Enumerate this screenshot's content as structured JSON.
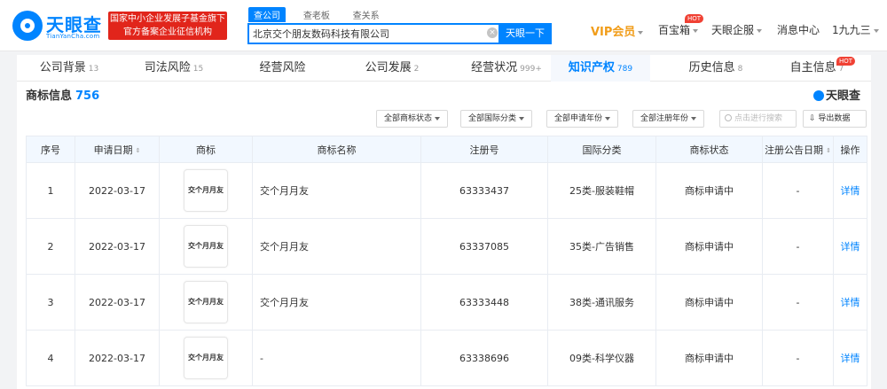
{
  "header": {
    "logo_name": "天眼查",
    "logo_sub": "TianYanCha.com",
    "fund_badge_line1": "国家中小企业发展子基金旗下",
    "fund_badge_line2": "官方备案企业征信机构",
    "search_tabs": [
      "查公司",
      "查老板",
      "查关系"
    ],
    "search_value": "北京交个朋友数码科技有限公司",
    "search_button": "天眼一下",
    "vip_label": "VIP会员",
    "nav_items": [
      "百宝箱",
      "天眼企服",
      "消息中心",
      "1九九三"
    ],
    "hot_label": "HOT"
  },
  "tabs": [
    {
      "label": "公司背景",
      "count": "13"
    },
    {
      "label": "司法风险",
      "count": "15"
    },
    {
      "label": "经营风险",
      "count": ""
    },
    {
      "label": "公司发展",
      "count": "2"
    },
    {
      "label": "经营状况",
      "count": "999+"
    },
    {
      "label": "知识产权",
      "count": "789"
    },
    {
      "label": "历史信息",
      "count": "8"
    },
    {
      "label": "自主信息",
      "count": "7"
    }
  ],
  "section": {
    "title": "商标信息",
    "count": "756",
    "brand": "天眼查"
  },
  "filters": {
    "status": "全部商标状态",
    "intl_class": "全部国际分类",
    "apply_year": "全部申请年份",
    "reg_year": "全部注册年份",
    "search_placeholder": "点击进行搜索",
    "export_label": "导出数据"
  },
  "table": {
    "columns": [
      "序号",
      "申请日期",
      "商标",
      "商标名称",
      "注册号",
      "国际分类",
      "商标状态",
      "注册公告日期",
      "操作"
    ],
    "rows": [
      {
        "no": "1",
        "date": "2022-03-17",
        "logo": "交个月月友",
        "name": "交个月月友",
        "reg_no": "63333437",
        "class": "25类-服装鞋帽",
        "status": "商标申请中",
        "notice_date": "-",
        "action": "详情"
      },
      {
        "no": "2",
        "date": "2022-03-17",
        "logo": "交个月月友",
        "name": "交个月月友",
        "reg_no": "63337085",
        "class": "35类-广告销售",
        "status": "商标申请中",
        "notice_date": "-",
        "action": "详情"
      },
      {
        "no": "3",
        "date": "2022-03-17",
        "logo": "交个月月友",
        "name": "交个月月友",
        "reg_no": "63333448",
        "class": "38类-通讯服务",
        "status": "商标申请中",
        "notice_date": "-",
        "action": "详情"
      },
      {
        "no": "4",
        "date": "2022-03-17",
        "logo": "交个月月友",
        "name": "-",
        "reg_no": "63338696",
        "class": "09类-科学仪器",
        "status": "商标申请中",
        "notice_date": "-",
        "action": "详情"
      }
    ]
  },
  "colors": {
    "accent": "#0084ff",
    "vip": "#f19d1a",
    "badge": "#e1251b",
    "hot": "#f04134"
  }
}
